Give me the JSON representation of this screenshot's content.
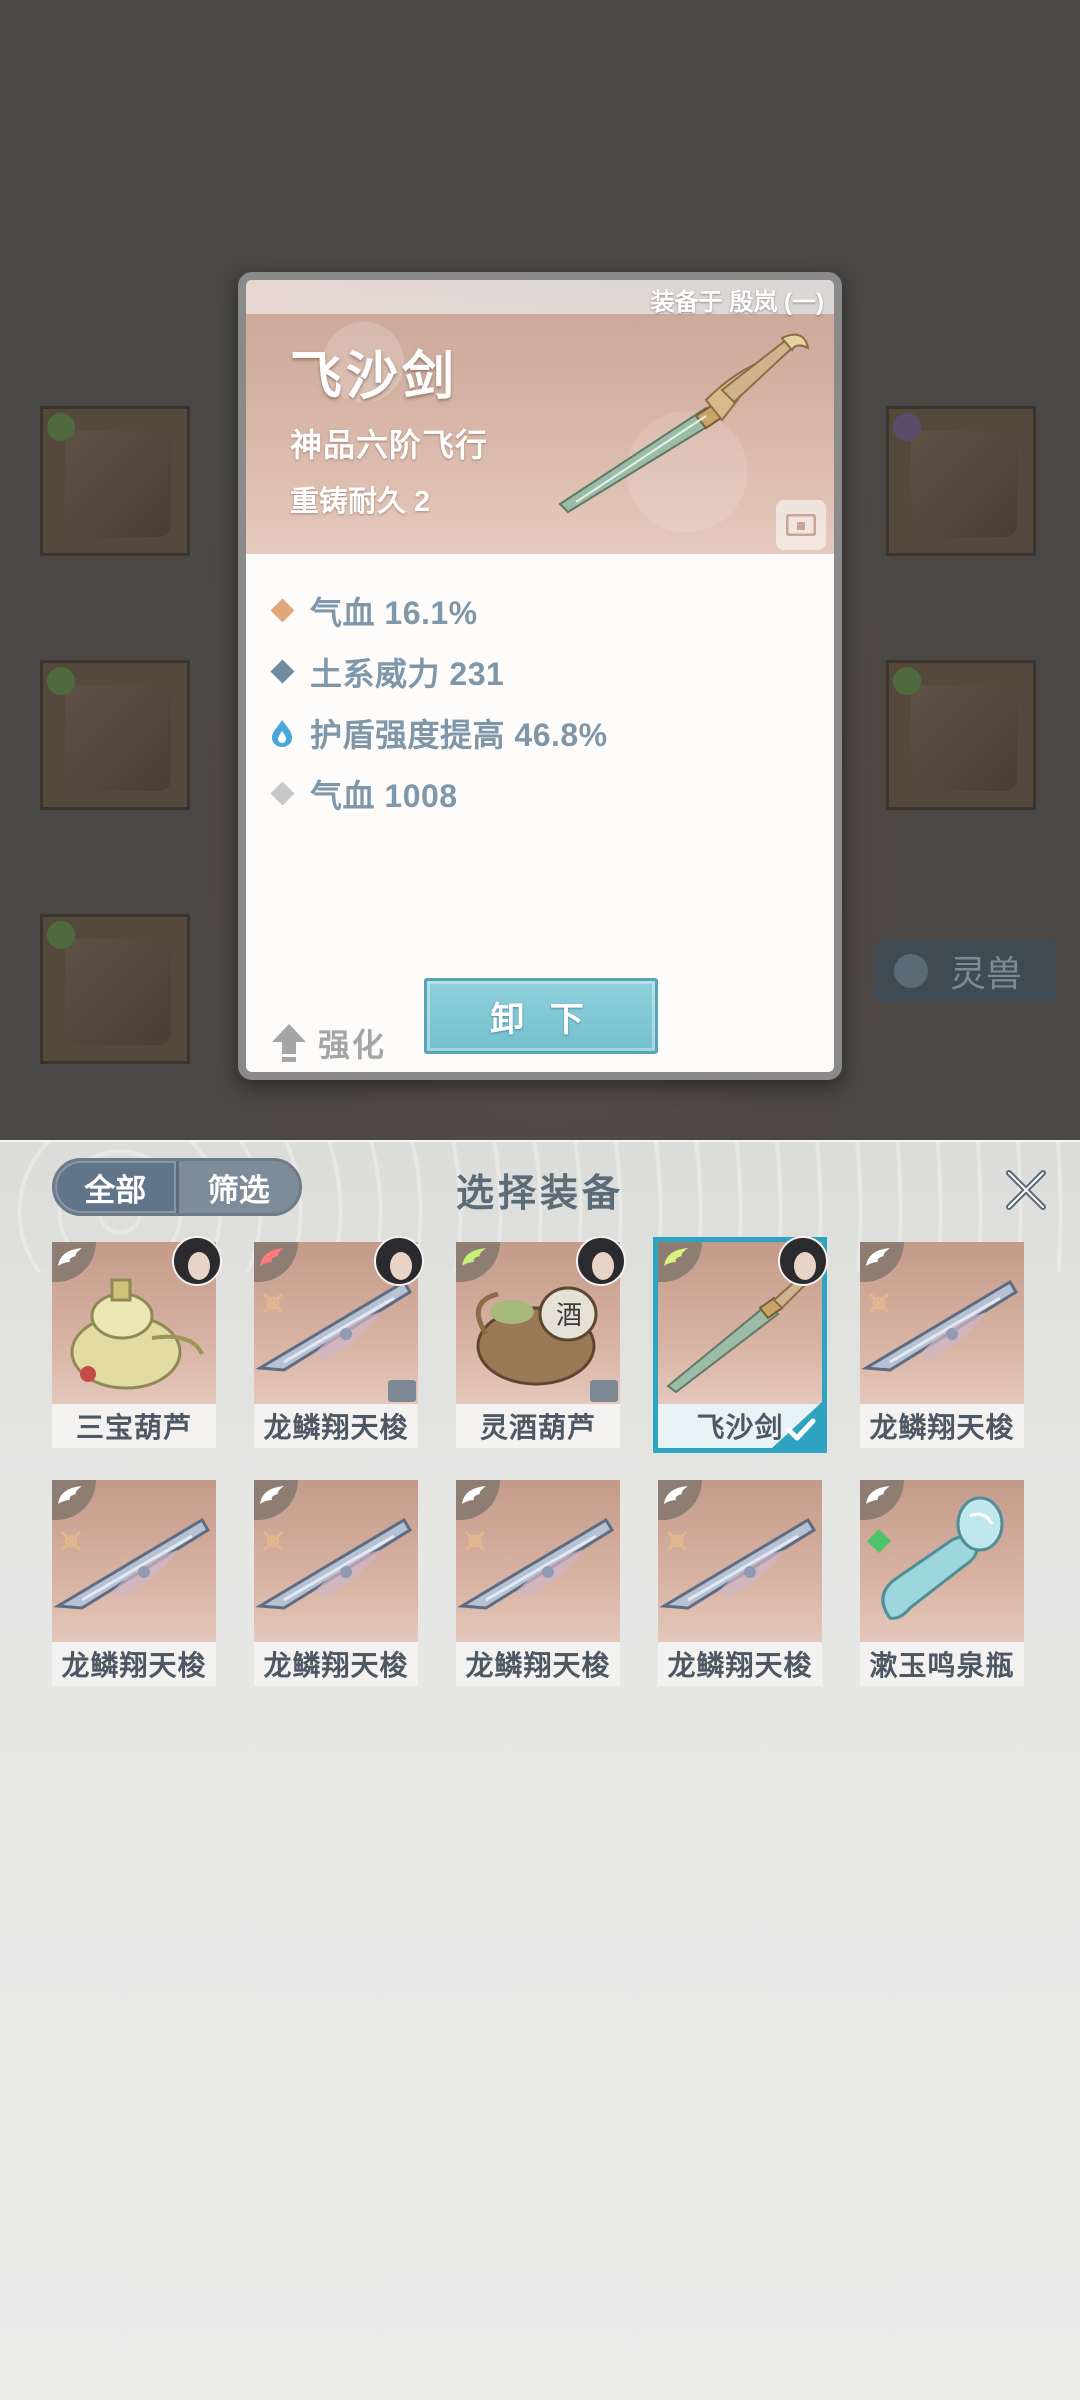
{
  "background": {
    "side_tab_label": "灵兽"
  },
  "detail": {
    "equipped_on": "装备于 殷岚 (一)",
    "name": "飞沙剑",
    "grade": "神品六阶飞行",
    "durability": "重铸耐久 2",
    "stats": [
      {
        "icon": "orange-diamond-icon",
        "color": "#e0a77a",
        "text": "气血 16.1%"
      },
      {
        "icon": "blue-diamond-icon",
        "color": "#6f8ca3",
        "text": "土系威力 231"
      },
      {
        "icon": "blue-flame-icon",
        "color": "#4aa6d8",
        "text": "护盾强度提高 46.8%"
      },
      {
        "icon": "gray-diamond-icon",
        "color": "#c8c8c8",
        "text": "气血 1008"
      }
    ],
    "enhance_label": "强化",
    "unequip_label": "卸 下"
  },
  "panel": {
    "title": "选择装备",
    "filter_all": "全部",
    "filter_screen": "筛选",
    "items": [
      {
        "name": "三宝葫芦",
        "kind": "gourd",
        "wing": "#ffffff",
        "avatar": true,
        "lock": false,
        "rune": false,
        "selected": false
      },
      {
        "name": "龙鳞翔天梭",
        "kind": "shuttle",
        "wing": "#ff7a7a",
        "avatar": true,
        "lock": true,
        "rune": true,
        "selected": false
      },
      {
        "name": "灵酒葫芦",
        "kind": "wine",
        "wing": "#c6f07a",
        "avatar": true,
        "lock": true,
        "rune": false,
        "selected": false
      },
      {
        "name": "飞沙剑",
        "kind": "sword",
        "wing": "#d9f07a",
        "avatar": true,
        "lock": false,
        "rune": false,
        "selected": true
      },
      {
        "name": "龙鳞翔天梭",
        "kind": "shuttle",
        "wing": "#ffffff",
        "avatar": false,
        "lock": false,
        "rune": true,
        "selected": false
      },
      {
        "name": "龙鳞翔天梭",
        "kind": "shuttle",
        "wing": "#ffffff",
        "avatar": false,
        "lock": false,
        "rune": true,
        "selected": false
      },
      {
        "name": "龙鳞翔天梭",
        "kind": "shuttle",
        "wing": "#ffffff",
        "avatar": false,
        "lock": false,
        "rune": true,
        "selected": false
      },
      {
        "name": "龙鳞翔天梭",
        "kind": "shuttle",
        "wing": "#ffffff",
        "avatar": false,
        "lock": false,
        "rune": true,
        "selected": false
      },
      {
        "name": "龙鳞翔天梭",
        "kind": "shuttle",
        "wing": "#ffffff",
        "avatar": false,
        "lock": false,
        "rune": true,
        "selected": false
      },
      {
        "name": "漱玉鸣泉瓶",
        "kind": "bottle",
        "wing": "#ffffff",
        "avatar": false,
        "lock": false,
        "rune": false,
        "selected": false,
        "gem": "#4fc36a"
      }
    ]
  },
  "colors": {
    "accent_selected": "#2fa4c0",
    "stat_text": "#7f97a9",
    "button_teal": "#74bfcd"
  }
}
